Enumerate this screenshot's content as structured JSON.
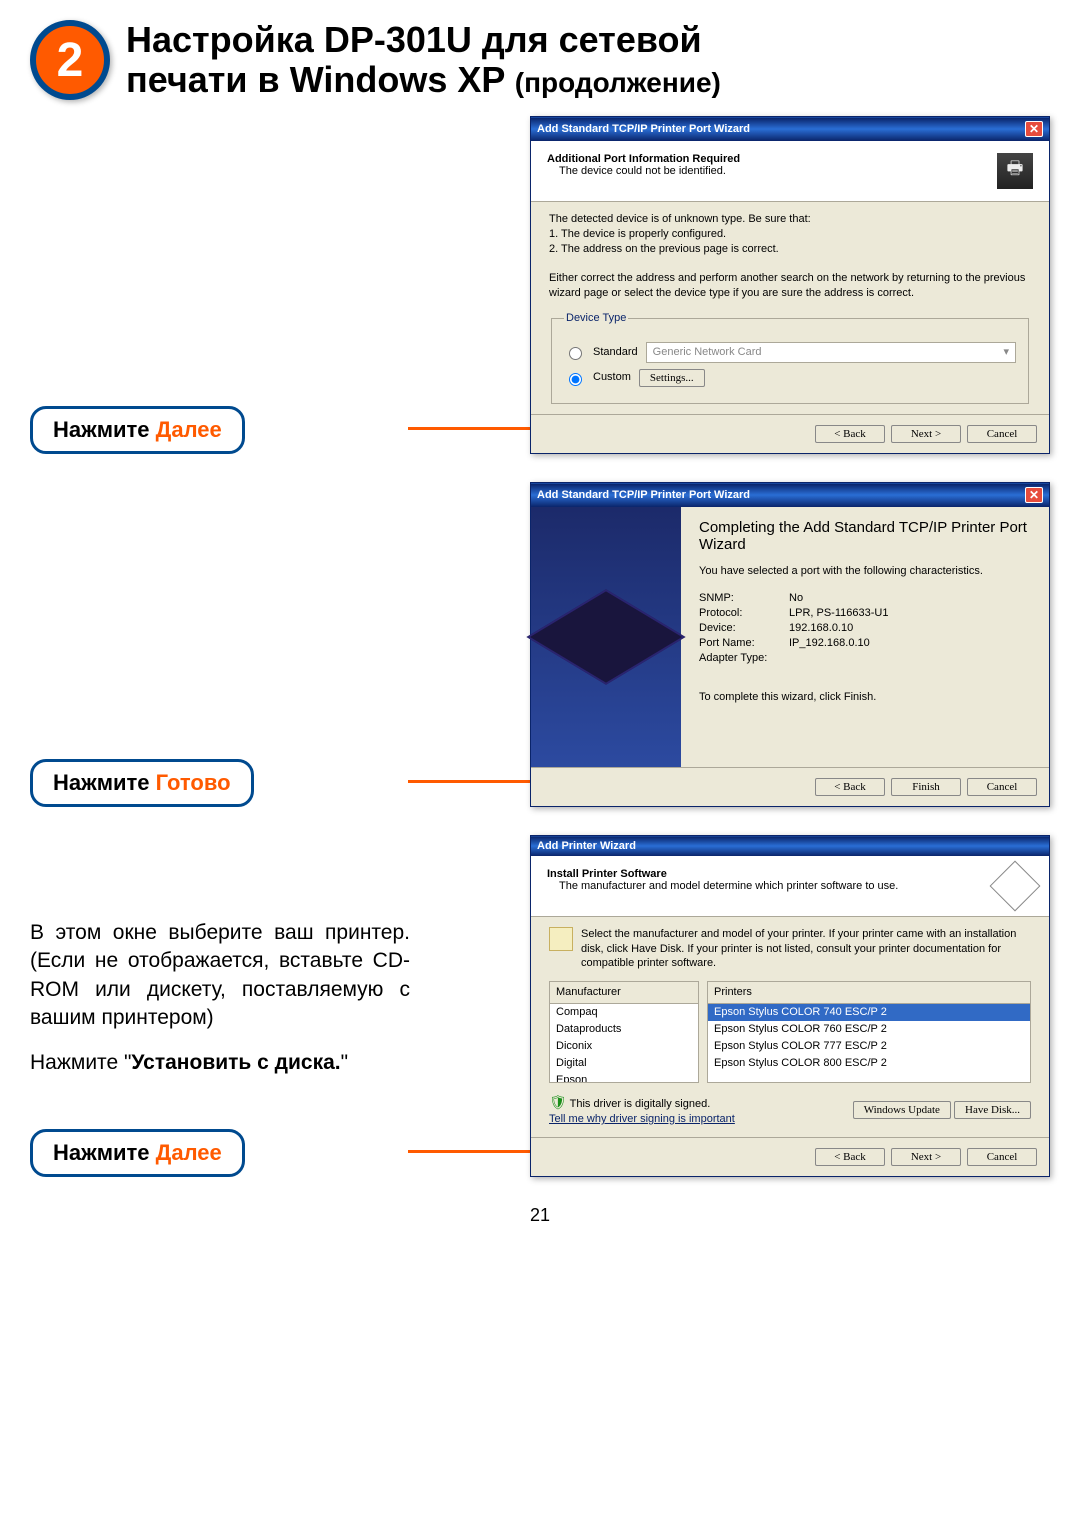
{
  "header": {
    "step_number": "2",
    "title_line1": "Настройка DP-301U для сетевой",
    "title_line2": "печати в Windows XP",
    "continuation": "(продолжение)"
  },
  "callouts": {
    "next1_prefix": "Нажмите ",
    "next1_hl": "Далее",
    "finish_prefix": "Нажмите ",
    "finish_hl": "Готово",
    "next2_prefix": "Нажмите ",
    "next2_hl": "Далее"
  },
  "instructions": {
    "select_printer": "В этом окне выберите ваш принтер. (Если не отображается, вставьте CD-ROM или дискету, поставляемую с вашим принтером)",
    "have_disk_prefix": "Нажмите \"",
    "have_disk_bold": "Установить с диска.",
    "have_disk_suffix": "\""
  },
  "dlg1": {
    "title": "Add Standard TCP/IP Printer Port Wizard",
    "hdr_bold": "Additional Port Information Required",
    "hdr_sub": "The device could not be identified.",
    "body_intro": "The detected device is of unknown type. Be sure that:",
    "body_li1": "1. The device is properly configured.",
    "body_li2": "2. The address on the previous page is correct.",
    "body_p2": "Either correct the address and perform another search on the network by returning to the previous wizard page or select the device type if you are sure the address is correct.",
    "legend": "Device Type",
    "radio_standard": "Standard",
    "dropdown_val": "Generic Network Card",
    "radio_custom": "Custom",
    "btn_settings": "Settings...",
    "btn_back": "< Back",
    "btn_next": "Next >",
    "btn_cancel": "Cancel"
  },
  "dlg2": {
    "title": "Add Standard TCP/IP Printer Port Wizard",
    "h1": "Completing the Add Standard TCP/IP Printer Port Wizard",
    "sub": "You have selected a port with the following characteristics.",
    "snmp_k": "SNMP:",
    "snmp_v": "No",
    "proto_k": "Protocol:",
    "proto_v": "LPR,  PS-116633-U1",
    "dev_k": "Device:",
    "dev_v": "192.168.0.10",
    "port_k": "Port Name:",
    "port_v": "IP_192.168.0.10",
    "adapter_k": "Adapter Type:",
    "finish_line": "To complete this wizard, click Finish.",
    "btn_back": "< Back",
    "btn_finish": "Finish",
    "btn_cancel": "Cancel"
  },
  "dlg3": {
    "title": "Add Printer Wizard",
    "hdr_bold": "Install Printer Software",
    "hdr_sub": "The manufacturer and model determine which printer software to use.",
    "instr": "Select the manufacturer and model of your printer. If your printer came with an installation disk, click Have Disk. If your printer is not listed, consult your printer documentation for compatible printer software.",
    "col_manuf": "Manufacturer",
    "col_printers": "Printers",
    "manuf_list": [
      "Compaq",
      "Dataproducts",
      "Diconix",
      "Digital",
      "Epson"
    ],
    "printer_list": [
      "Epson Stylus COLOR 740 ESC/P 2",
      "Epson Stylus COLOR 760 ESC/P 2",
      "Epson Stylus COLOR 777 ESC/P 2",
      "Epson Stylus COLOR 800 ESC/P 2"
    ],
    "signed": "This driver is digitally signed.",
    "why": "Tell me why driver signing is important",
    "btn_wu": "Windows Update",
    "btn_hd": "Have Disk...",
    "btn_back": "< Back",
    "btn_next": "Next >",
    "btn_cancel": "Cancel"
  },
  "page_number": "21"
}
